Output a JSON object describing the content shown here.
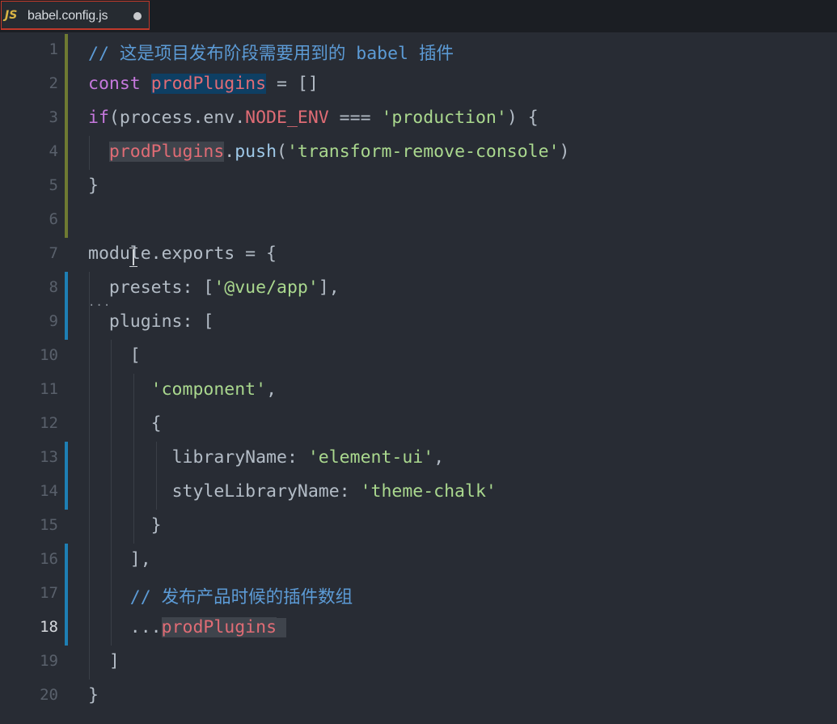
{
  "tab": {
    "icon": "JS",
    "filename": "babel.config.js",
    "modified_indicator": "dot-icon"
  },
  "editor": {
    "active_line": 18,
    "lines": [
      {
        "num": "1",
        "text": "// 这是项目发布阶段需要用到的 babel 插件"
      },
      {
        "num": "2",
        "text": "const prodPlugins = []"
      },
      {
        "num": "3",
        "text": "if(process.env.NODE_ENV === 'production') {"
      },
      {
        "num": "4",
        "text": "  prodPlugins.push('transform-remove-console')"
      },
      {
        "num": "5",
        "text": "}"
      },
      {
        "num": "6",
        "text": ""
      },
      {
        "num": "7",
        "text": "module.exports = {"
      },
      {
        "num": "8",
        "text": "  presets: ['@vue/app'],"
      },
      {
        "num": "9",
        "text": "  plugins: ["
      },
      {
        "num": "10",
        "text": "    ["
      },
      {
        "num": "11",
        "text": "      'component',"
      },
      {
        "num": "12",
        "text": "      {"
      },
      {
        "num": "13",
        "text": "        libraryName: 'element-ui',"
      },
      {
        "num": "14",
        "text": "        styleLibraryName: 'theme-chalk'"
      },
      {
        "num": "15",
        "text": "      }"
      },
      {
        "num": "16",
        "text": "    ],"
      },
      {
        "num": "17",
        "text": "    // 发布产品时候的插件数组"
      },
      {
        "num": "18",
        "text": "    ...prodPlugins"
      },
      {
        "num": "19",
        "text": "  ]"
      },
      {
        "num": "20",
        "text": "}"
      }
    ]
  },
  "colors": {
    "background": "#282c34",
    "comment": "#5c9bd6",
    "keyword": "#c678dd",
    "variable": "#e06c75",
    "string": "#aad88e",
    "modified_bar": "#6e7a32",
    "added_bar": "#1e7fb4",
    "tab_border": "#c0392b"
  }
}
